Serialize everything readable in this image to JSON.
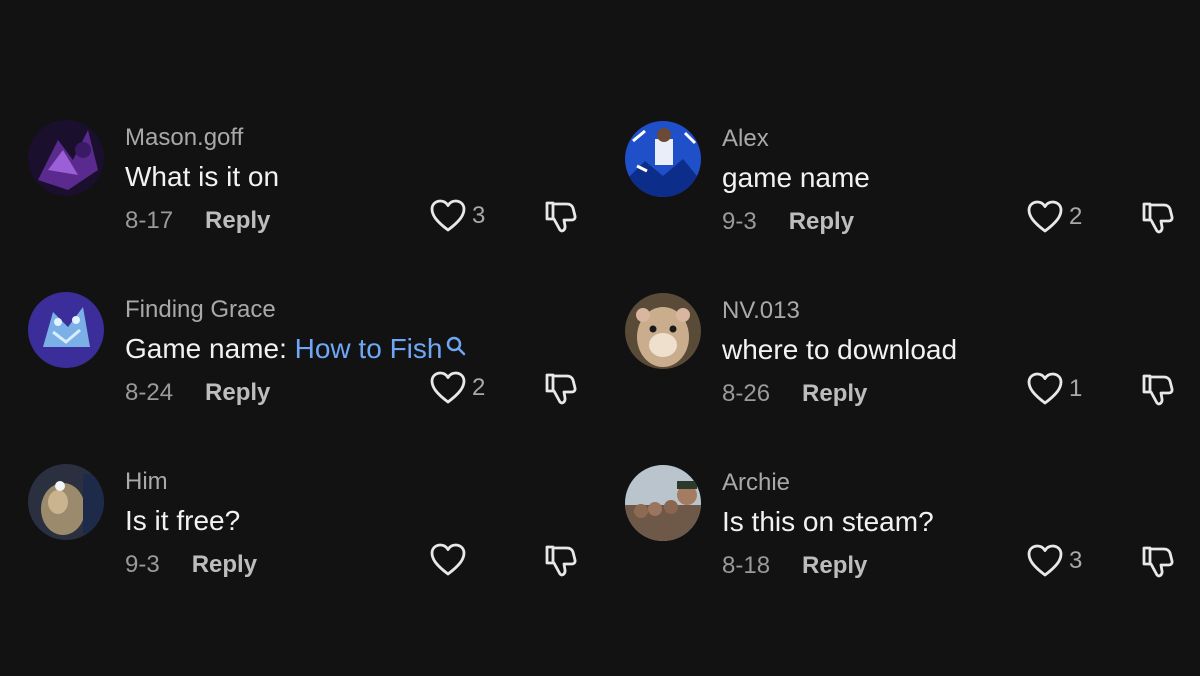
{
  "comments": [
    {
      "username": "Mason.goff",
      "text": "What is it on",
      "link_text": "",
      "date": "8-17",
      "reply_label": "Reply",
      "likes": "3",
      "avatar": "purple-abstract-avatar"
    },
    {
      "username": "Finding Grace",
      "text": "Game name: ",
      "link_text": "How to Fish",
      "date": "8-24",
      "reply_label": "Reply",
      "likes": "2",
      "avatar": "blue-cat-avatar"
    },
    {
      "username": "Him",
      "text": "Is it free?",
      "link_text": "",
      "date": "9-3",
      "reply_label": "Reply",
      "likes": "",
      "avatar": "cat-photo-avatar"
    },
    {
      "username": "Alex",
      "text": "game name",
      "link_text": "",
      "date": "9-3",
      "reply_label": "Reply",
      "likes": "2",
      "avatar": "football-player-avatar"
    },
    {
      "username": "NV.013",
      "text": "where to download",
      "link_text": "",
      "date": "8-26",
      "reply_label": "Reply",
      "likes": "1",
      "avatar": "hamster-avatar"
    },
    {
      "username": "Archie",
      "text": "Is this on steam?",
      "link_text": "",
      "date": "8-18",
      "reply_label": "Reply",
      "likes": "3",
      "avatar": "group-photo-avatar"
    }
  ],
  "colors": {
    "background": "#121212",
    "link": "#6ea7f5",
    "username": "#a9a9a9",
    "text": "#f2f2f2"
  }
}
